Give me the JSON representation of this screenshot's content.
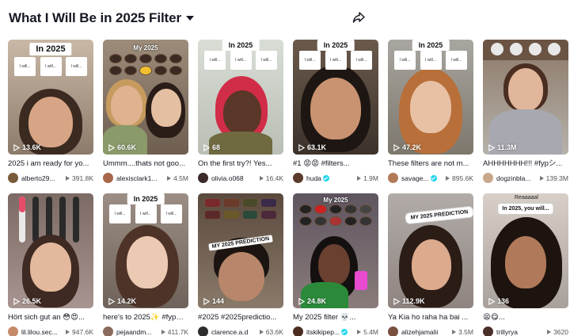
{
  "header": {
    "title": "What I Will Be in 2025 Filter"
  },
  "overlays": {
    "in2025": "In 2025",
    "my2025": "My 2025",
    "mini": "I will...",
    "prediction": "MY 2025 PREDICTION",
    "in2025_you_will": "In 2025, you will...",
    "reaaal": "Reaaaaal"
  },
  "videos": [
    {
      "views": "13.6K",
      "caption": "2025 i am ready for yo...",
      "author": "alberto29...",
      "verified": false,
      "plays": "391.8K",
      "avatar_color": "#7a5a3c"
    },
    {
      "views": "60.6K",
      "caption": "Ummm....thats not goo...",
      "author": "alexisclark1...",
      "verified": false,
      "plays": "4.5M",
      "avatar_color": "#a8674a"
    },
    {
      "views": "68",
      "caption": "On the first try?! Yes...",
      "author": "olivia.o068",
      "verified": false,
      "plays": "16.4K",
      "avatar_color": "#3a2a2a"
    },
    {
      "views": "63.1K",
      "caption": "#1 😡😡 #filters...",
      "author": "huda",
      "verified": true,
      "plays": "1.9M",
      "avatar_color": "#5a3b2c"
    },
    {
      "views": "47.2K",
      "caption": "These filters are not m...",
      "author": "savage...",
      "verified": true,
      "plays": "895.6K",
      "avatar_color": "#b37a5a"
    },
    {
      "views": "11.3M",
      "caption": "AHHHHHHH!!! #fypシ...",
      "author": "dogzinbla...",
      "verified": false,
      "plays": "139.3M",
      "avatar_color": "#c9a88a"
    },
    {
      "views": "26.5K",
      "caption": "Hört sich gut an 😳😍...",
      "author": "lil.lilou.sec...",
      "verified": false,
      "plays": "947.6K",
      "avatar_color": "#c48a6a"
    },
    {
      "views": "14.2K",
      "caption": "here's to 2025✨ #fypシ...",
      "author": "pejaandm...",
      "verified": false,
      "plays": "411.7K",
      "avatar_color": "#8a6a5a"
    },
    {
      "views": "144",
      "caption": "#2025 #2025predictio...",
      "author": "clarence.a.d",
      "verified": false,
      "plays": "63.6K",
      "avatar_color": "#2d2d2d"
    },
    {
      "views": "24.8K",
      "caption": "My 2025 filter 💀...",
      "author": "itskikipep...",
      "verified": true,
      "plays": "5.4M",
      "avatar_color": "#4a2c20"
    },
    {
      "views": "112.9K",
      "caption": "Ya Kia ho raha ha bai ...",
      "author": "alizehjamalii",
      "verified": false,
      "plays": "3.5M",
      "avatar_color": "#7a5040"
    },
    {
      "views": "136",
      "caption": "😫😋...",
      "author": "trillyrya",
      "verified": false,
      "plays": "3620",
      "avatar_color": "#4a3028"
    }
  ],
  "colors": {
    "accent_verified": "#20d5ec",
    "text": "#161823"
  },
  "icons": {
    "share": "share-arrow-icon",
    "views": "play-outline-icon",
    "plays": "play-triangle-icon"
  }
}
